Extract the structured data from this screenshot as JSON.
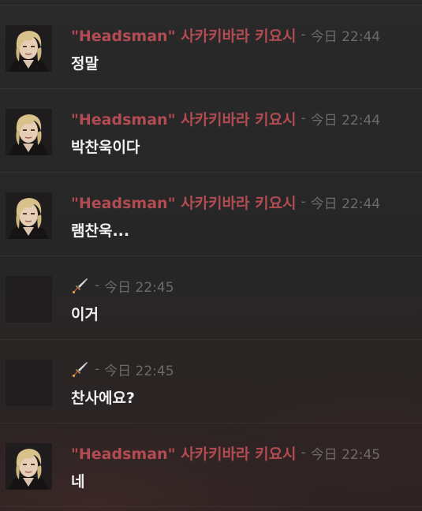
{
  "messages": [
    {
      "author": "\"Headsman\" 사카키바라 키요시",
      "separator": "-",
      "time": "今日 22:44",
      "text": "정말",
      "avatar": "character-portrait",
      "author_icon": null
    },
    {
      "author": "\"Headsman\" 사카키바라 키요시",
      "separator": "-",
      "time": "今日 22:44",
      "text": "박찬욱이다",
      "avatar": "character-portrait",
      "author_icon": null
    },
    {
      "author": "\"Headsman\" 사카키바라 키요시",
      "separator": "-",
      "time": "今日 22:44",
      "text": "램찬욱...",
      "avatar": "character-portrait",
      "author_icon": null
    },
    {
      "author": "",
      "separator": "-",
      "time": "今日 22:45",
      "text": "이거",
      "avatar": "blank",
      "author_icon": "dagger-icon"
    },
    {
      "author": "",
      "separator": "-",
      "time": "今日 22:45",
      "text": "찬사에요?",
      "avatar": "blank",
      "author_icon": "dagger-icon"
    },
    {
      "author": "\"Headsman\" 사카키바라 키요시",
      "separator": "-",
      "time": "今日 22:45",
      "text": "네",
      "avatar": "character-portrait",
      "author_icon": null
    }
  ],
  "colors": {
    "username": "#b34b52",
    "timestamp": "#6e6a6a",
    "message_text": "#f2f0f0",
    "background": "#292929"
  }
}
